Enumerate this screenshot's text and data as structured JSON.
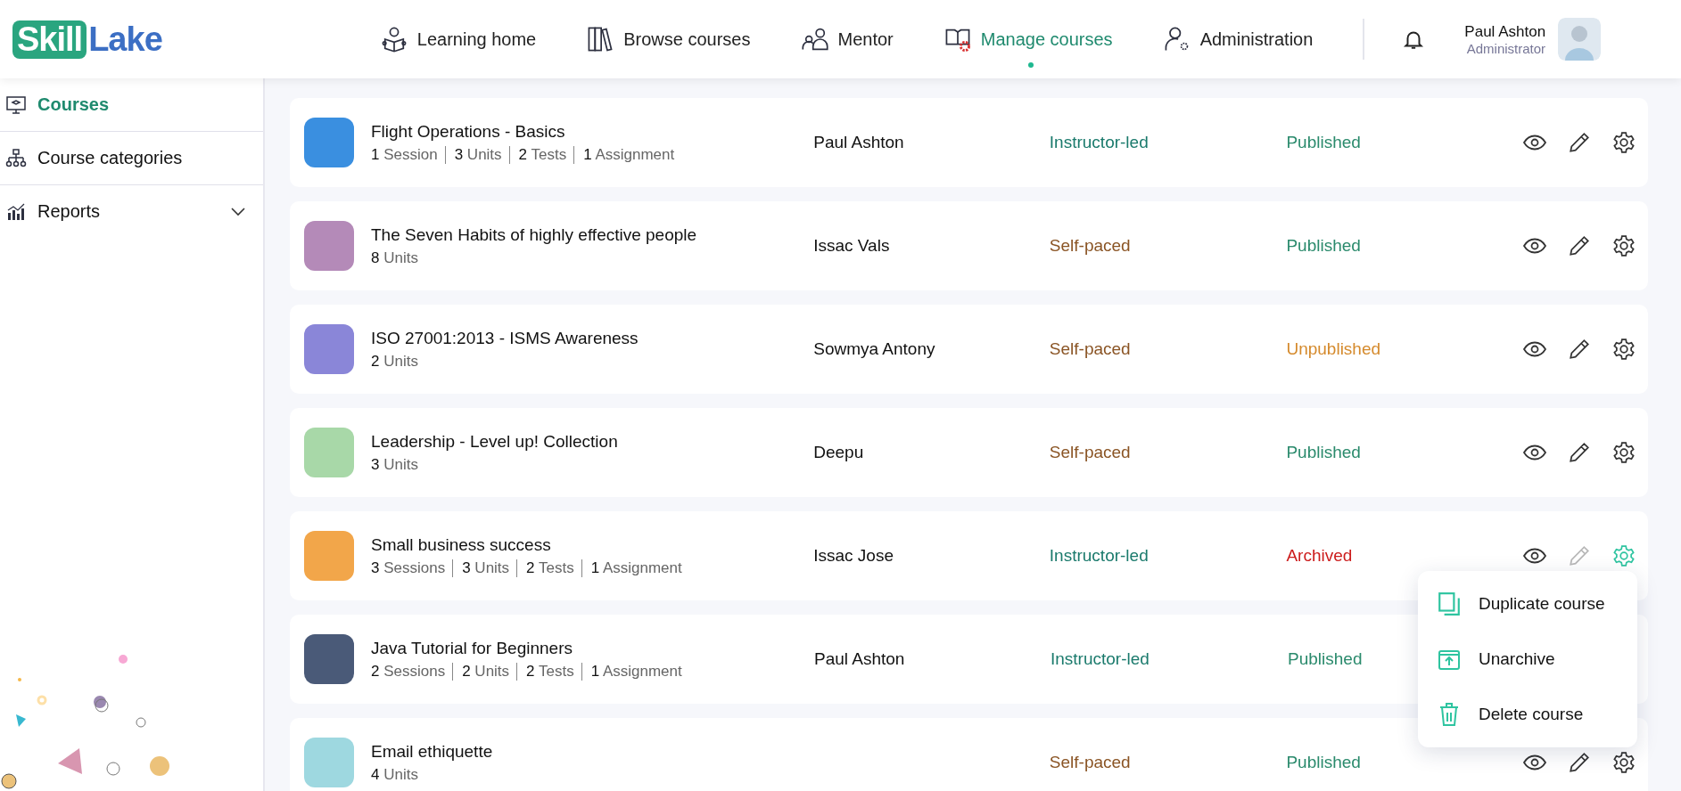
{
  "brand": {
    "part_1": "Skill",
    "part_2": "Lake"
  },
  "nav": [
    {
      "label": "Learning home",
      "selected": false
    },
    {
      "label": "Browse courses",
      "selected": false
    },
    {
      "label": "Mentor",
      "selected": false
    },
    {
      "label": "Manage courses",
      "selected": true
    },
    {
      "label": "Administration",
      "selected": false
    }
  ],
  "user": {
    "name": "Paul Ashton",
    "role": "Administrator"
  },
  "sidebar": {
    "items": [
      {
        "label": "Courses",
        "selected": true,
        "expandable": false
      },
      {
        "label": "Course categories",
        "selected": false,
        "expandable": false
      },
      {
        "label": "Reports",
        "selected": false,
        "expandable": true
      }
    ]
  },
  "courses": [
    {
      "title": "Flight Operations - Basics",
      "meta": [
        {
          "count": "1",
          "label": "Session"
        },
        {
          "count": "3",
          "label": "Units"
        },
        {
          "count": "2",
          "label": "Tests"
        },
        {
          "count": "1",
          "label": "Assignment"
        }
      ],
      "instructor": "Paul Ashton",
      "type": {
        "text": "Instructor-led",
        "color": "#1a7a6c"
      },
      "status": {
        "text": "Published",
        "color": "#2a8a6c"
      },
      "edit_disabled": false,
      "menu_open": false
    },
    {
      "title": "The Seven Habits of highly effective people",
      "meta": [
        {
          "count": "8",
          "label": "Units"
        }
      ],
      "instructor": "Issac Vals",
      "type": {
        "text": "Self-paced",
        "color": "#8a5424"
      },
      "status": {
        "text": "Published",
        "color": "#2a8a6c"
      },
      "edit_disabled": false,
      "menu_open": false
    },
    {
      "title": "ISO 27001:2013 - ISMS Awareness",
      "meta": [
        {
          "count": "2",
          "label": "Units"
        }
      ],
      "instructor": "Sowmya Antony",
      "type": {
        "text": "Self-paced",
        "color": "#8a5424"
      },
      "status": {
        "text": "Unpublished",
        "color": "#d58a2c"
      },
      "edit_disabled": false,
      "menu_open": false
    },
    {
      "title": "Leadership - Level up! Collection",
      "meta": [
        {
          "count": "3",
          "label": "Units"
        }
      ],
      "instructor": "Deepu",
      "type": {
        "text": "Self-paced",
        "color": "#8a5424"
      },
      "status": {
        "text": "Published",
        "color": "#2a8a6c"
      },
      "edit_disabled": false,
      "menu_open": false
    },
    {
      "title": "Small business success",
      "meta": [
        {
          "count": "3",
          "label": "Sessions"
        },
        {
          "count": "3",
          "label": "Units"
        },
        {
          "count": "2",
          "label": "Tests"
        },
        {
          "count": "1",
          "label": "Assignment"
        }
      ],
      "instructor": "Issac Jose",
      "type": {
        "text": "Instructor-led",
        "color": "#1a7a6c"
      },
      "status": {
        "text": "Archived",
        "color": "#cc1c1c"
      },
      "edit_disabled": true,
      "menu_open": true
    },
    {
      "title": "Java Tutorial for Beginners",
      "meta": [
        {
          "count": "2",
          "label": "Sessions"
        },
        {
          "count": "2",
          "label": "Units"
        },
        {
          "count": "2",
          "label": "Tests"
        },
        {
          "count": "1",
          "label": "Assignment"
        }
      ],
      "instructor": "Paul Ashton",
      "type": {
        "text": "Instructor-led",
        "color": "#1a7a6c"
      },
      "status": {
        "text": "Published",
        "color": "#2a8a6c"
      }
    },
    {
      "title": "Email ethiquette",
      "meta": [
        {
          "count": "4",
          "label": "Units"
        }
      ],
      "type": {
        "text": "Self-paced",
        "color": "#8a5424"
      },
      "status": {
        "text": "Published",
        "color": "#2a8a6c"
      },
      "edit_disabled": false,
      "menu_open": false
    }
  ],
  "menu": [
    {
      "label": "Duplicate course"
    },
    {
      "label": "Unarchive"
    },
    {
      "label": "Delete course"
    }
  ]
}
